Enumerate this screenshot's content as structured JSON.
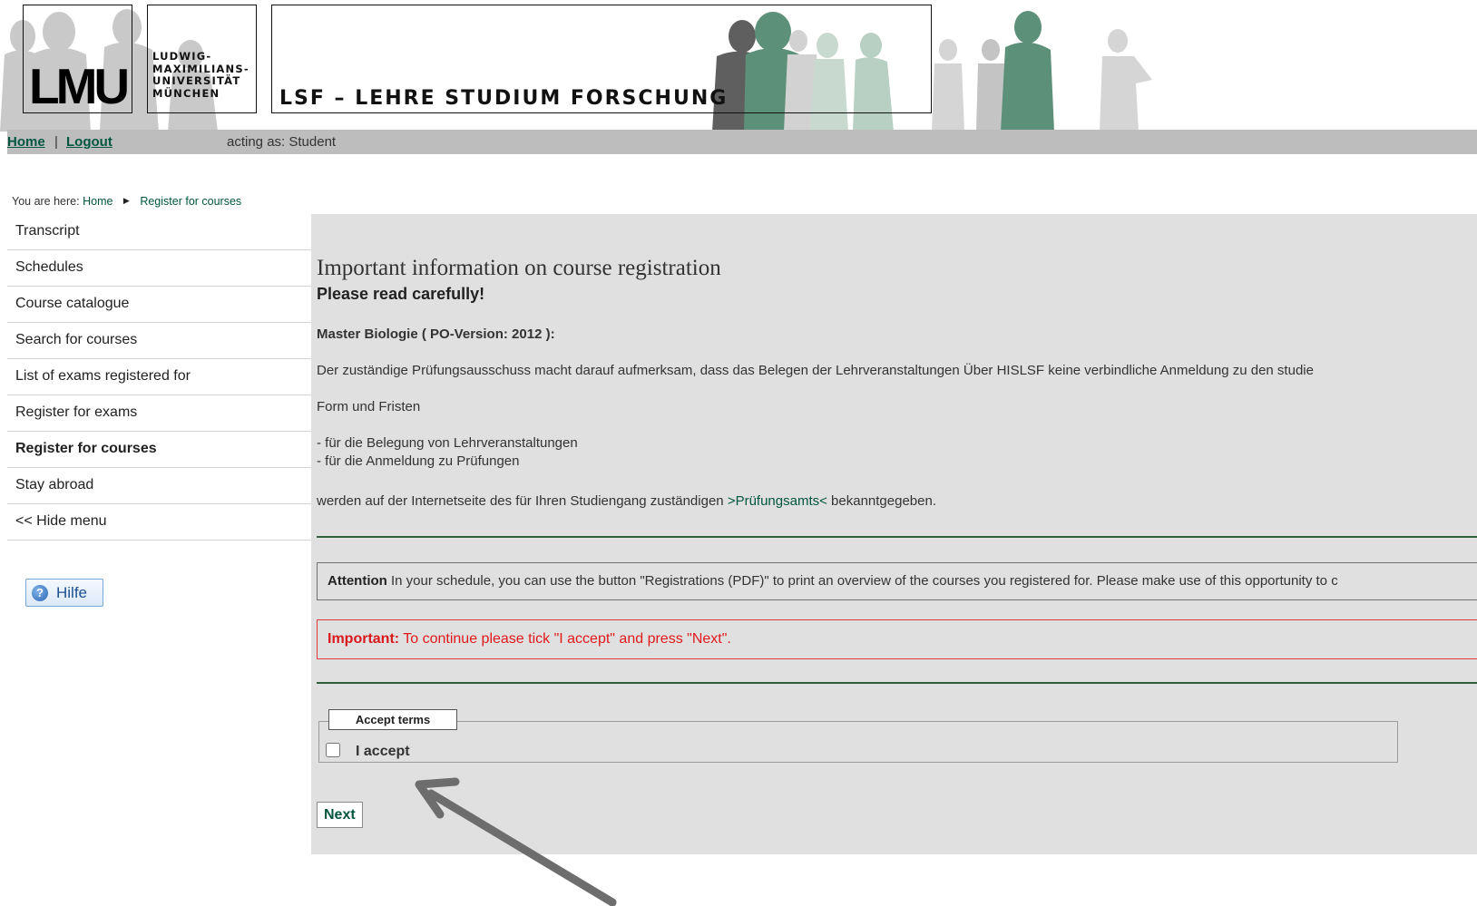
{
  "header": {
    "logo_text": "LMU",
    "university_name": "LUDWIG-\nMAXIMILIANS-\nUNIVERSITÄT\nMÜNCHEN",
    "system_title": "LSF – LEHRE STUDIUM FORSCHUNG"
  },
  "topbar": {
    "home_label": "Home",
    "separator": "|",
    "logout_label": "Logout",
    "acting_as": "acting as: Student"
  },
  "breadcrumb": {
    "prefix": "You are here:",
    "items": [
      "Home",
      "Register for courses"
    ]
  },
  "sidebar": {
    "items": [
      {
        "label": "Transcript",
        "active": false
      },
      {
        "label": "Schedules",
        "active": false
      },
      {
        "label": "Course catalogue",
        "active": false
      },
      {
        "label": "Search for courses",
        "active": false
      },
      {
        "label": "List of exams registered for",
        "active": false
      },
      {
        "label": "Register for exams",
        "active": false
      },
      {
        "label": "Register for courses",
        "active": true
      },
      {
        "label": "Stay abroad",
        "active": false
      },
      {
        "label": "<< Hide menu",
        "active": false
      }
    ],
    "help_label": "Hilfe"
  },
  "main": {
    "title": "Important information on course registration",
    "subtitle": "Please read carefully!",
    "program": "Master Biologie ( PO-Version: 2012 ):",
    "paragraph1": "Der zuständige Prüfungsausschuss macht darauf aufmerksam, dass das Belegen der Lehrveranstaltungen Über HISLSF keine verbindliche Anmeldung zu den studie",
    "paragraph2": "Form und Fristen",
    "bullet1": "- für die Belegung von Lehrveranstaltungen",
    "bullet2": "- für die Anmeldung zu Prüfungen",
    "paragraph4_before": "werden auf der Internetseite des für Ihren Studiengang zuständigen ",
    "paragraph4_link": ">Prüfungsamts<",
    "paragraph4_after": " bekanntgegeben.",
    "attention_label": "Attention",
    "attention_text": " In your schedule, you can use the button \"Registrations (PDF)\" to print an overview of the courses you registered for. Please make use of this opportunity to c",
    "important_label": "Important:",
    "important_text": " To continue please tick \"I accept\" and press \"Next\".",
    "legend": "Accept terms",
    "accept_label": "I accept",
    "accept_checked": false,
    "next_label": "Next"
  },
  "colors": {
    "brand_green": "#00563f",
    "panel_gray": "#e0e0e0",
    "topbar_gray": "#bdbdbd",
    "important_red": "#e0191c",
    "divider_green": "#2f5e3d"
  }
}
